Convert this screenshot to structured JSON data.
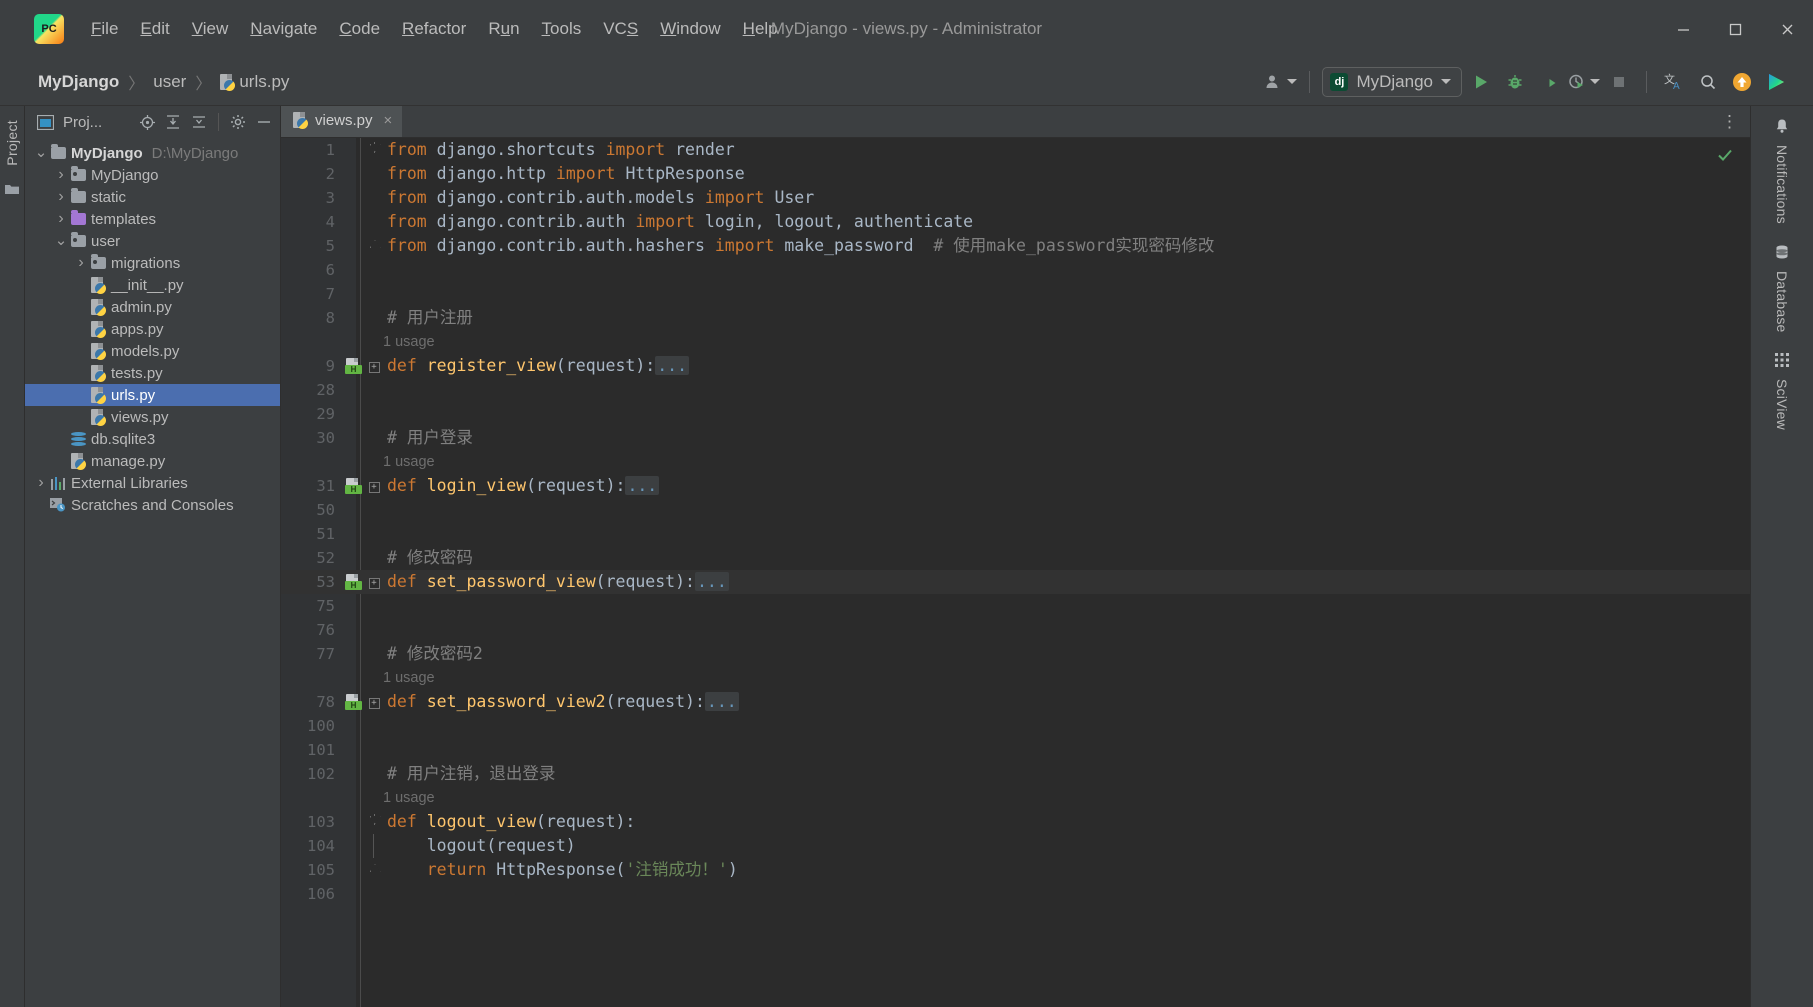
{
  "window": {
    "title": "MyDjango - views.py - Administrator",
    "minimize_label": "minimize-icon",
    "maximize_label": "maximize-icon",
    "close_label": "close-icon"
  },
  "menu": [
    {
      "label": "File",
      "mnemonic": "F"
    },
    {
      "label": "Edit",
      "mnemonic": "E"
    },
    {
      "label": "View",
      "mnemonic": "V"
    },
    {
      "label": "Navigate",
      "mnemonic": "N"
    },
    {
      "label": "Code",
      "mnemonic": "C"
    },
    {
      "label": "Refactor",
      "mnemonic": "R"
    },
    {
      "label": "Run",
      "mnemonic": "u"
    },
    {
      "label": "Tools",
      "mnemonic": "T"
    },
    {
      "label": "VCS",
      "mnemonic": "S"
    },
    {
      "label": "Window",
      "mnemonic": "W"
    },
    {
      "label": "Help",
      "mnemonic": "H"
    }
  ],
  "breadcrumbs": [
    {
      "label": "MyDjango",
      "bold": true,
      "icon": null
    },
    {
      "label": "user",
      "bold": false,
      "icon": null
    },
    {
      "label": "urls.py",
      "bold": false,
      "icon": "python-file-icon"
    }
  ],
  "toolbar": {
    "account_icon": "user-account-icon",
    "run_config": {
      "badge": "dj",
      "name": "MyDjango"
    },
    "run_icon": "run-icon",
    "debug_icon": "debug-icon",
    "coverage_icon": "run-with-coverage-icon",
    "profile_icon": "profiler-icon",
    "stop_icon": "stop-icon",
    "translate_icon": "translate-icon",
    "search_icon": "search-everywhere-icon",
    "update_icon": "update-project-icon",
    "ide_icon": "ide-feature-trainer-icon"
  },
  "left_strip": {
    "tabs": [
      {
        "label": "Project",
        "icon": "project-icon"
      }
    ],
    "structure_icon": "folder-strip-icon"
  },
  "project_panel": {
    "title": "Proj...",
    "header_icons": [
      "project-view-icon",
      "locate-icon",
      "expand-all-icon",
      "collapse-all-icon",
      "settings-gear-icon",
      "hide-icon"
    ],
    "tree": [
      {
        "label": "MyDjango",
        "sub": "D:\\MyDjango",
        "icon": "folder",
        "depth": 0,
        "twist": "open",
        "bold": true,
        "selected": false
      },
      {
        "label": "MyDjango",
        "sub": "",
        "icon": "folder-module",
        "depth": 1,
        "twist": "closed",
        "bold": false,
        "selected": false
      },
      {
        "label": "static",
        "sub": "",
        "icon": "folder",
        "depth": 1,
        "twist": "closed",
        "bold": false,
        "selected": false
      },
      {
        "label": "templates",
        "sub": "",
        "icon": "folder-purple",
        "depth": 1,
        "twist": "closed",
        "bold": false,
        "selected": false
      },
      {
        "label": "user",
        "sub": "",
        "icon": "folder-module",
        "depth": 1,
        "twist": "open",
        "bold": false,
        "selected": false
      },
      {
        "label": "migrations",
        "sub": "",
        "icon": "folder-module",
        "depth": 2,
        "twist": "closed",
        "bold": false,
        "selected": false
      },
      {
        "label": "__init__.py",
        "sub": "",
        "icon": "python",
        "depth": 2,
        "twist": "none",
        "bold": false,
        "selected": false
      },
      {
        "label": "admin.py",
        "sub": "",
        "icon": "python",
        "depth": 2,
        "twist": "none",
        "bold": false,
        "selected": false
      },
      {
        "label": "apps.py",
        "sub": "",
        "icon": "python",
        "depth": 2,
        "twist": "none",
        "bold": false,
        "selected": false
      },
      {
        "label": "models.py",
        "sub": "",
        "icon": "python",
        "depth": 2,
        "twist": "none",
        "bold": false,
        "selected": false
      },
      {
        "label": "tests.py",
        "sub": "",
        "icon": "python",
        "depth": 2,
        "twist": "none",
        "bold": false,
        "selected": false
      },
      {
        "label": "urls.py",
        "sub": "",
        "icon": "python",
        "depth": 2,
        "twist": "none",
        "bold": false,
        "selected": true
      },
      {
        "label": "views.py",
        "sub": "",
        "icon": "python",
        "depth": 2,
        "twist": "none",
        "bold": false,
        "selected": false
      },
      {
        "label": "db.sqlite3",
        "sub": "",
        "icon": "database",
        "depth": 1,
        "twist": "none",
        "bold": false,
        "selected": false
      },
      {
        "label": "manage.py",
        "sub": "",
        "icon": "python",
        "depth": 1,
        "twist": "none",
        "bold": false,
        "selected": false
      },
      {
        "label": "External Libraries",
        "sub": "",
        "icon": "libraries",
        "depth": 0,
        "twist": "closed",
        "bold": false,
        "selected": false
      },
      {
        "label": "Scratches and Consoles",
        "sub": "",
        "icon": "scratches",
        "depth": 0,
        "twist": "none",
        "bold": false,
        "selected": false
      }
    ]
  },
  "editor": {
    "tabs": [
      {
        "label": "views.py",
        "icon": "python-file-icon",
        "active": true,
        "close": "×"
      }
    ],
    "options_icon": "editor-options-icon",
    "inspection_status": "inspections-ok-icon",
    "lines": [
      {
        "num": "1",
        "fold": "top",
        "gicon": "",
        "caret": false,
        "tokens": [
          {
            "t": "from ",
            "c": "kw"
          },
          {
            "t": "django.shortcuts ",
            "c": "id"
          },
          {
            "t": "import ",
            "c": "kw"
          },
          {
            "t": "render",
            "c": "id"
          }
        ]
      },
      {
        "num": "2",
        "fold": "",
        "gicon": "",
        "caret": false,
        "tokens": [
          {
            "t": "from ",
            "c": "kw"
          },
          {
            "t": "django.http ",
            "c": "id"
          },
          {
            "t": "import ",
            "c": "kw"
          },
          {
            "t": "HttpResponse",
            "c": "id"
          }
        ]
      },
      {
        "num": "3",
        "fold": "",
        "gicon": "",
        "caret": false,
        "tokens": [
          {
            "t": "from ",
            "c": "kw"
          },
          {
            "t": "django.contrib.auth.models ",
            "c": "id"
          },
          {
            "t": "import ",
            "c": "kw"
          },
          {
            "t": "User",
            "c": "id"
          }
        ]
      },
      {
        "num": "4",
        "fold": "",
        "gicon": "",
        "caret": false,
        "tokens": [
          {
            "t": "from ",
            "c": "kw"
          },
          {
            "t": "django.contrib.auth ",
            "c": "id"
          },
          {
            "t": "import ",
            "c": "kw"
          },
          {
            "t": "login, logout, authenticate",
            "c": "id"
          }
        ]
      },
      {
        "num": "5",
        "fold": "bot",
        "gicon": "",
        "caret": false,
        "tokens": [
          {
            "t": "from ",
            "c": "kw"
          },
          {
            "t": "django.contrib.auth.hashers ",
            "c": "id"
          },
          {
            "t": "import ",
            "c": "kw"
          },
          {
            "t": "make_password",
            "c": "id"
          },
          {
            "t": "  # 使用make_password实现密码修改",
            "c": "cmt"
          }
        ]
      },
      {
        "num": "6",
        "fold": "",
        "gicon": "",
        "caret": false,
        "tokens": []
      },
      {
        "num": "7",
        "fold": "",
        "gicon": "",
        "caret": false,
        "tokens": []
      },
      {
        "num": "8",
        "fold": "",
        "gicon": "",
        "caret": false,
        "tokens": [
          {
            "t": "# 用户注册",
            "c": "cmt"
          }
        ]
      },
      {
        "num": "",
        "fold": "",
        "gicon": "",
        "caret": false,
        "usage": "1 usage",
        "tokens": []
      },
      {
        "num": "9",
        "fold": "box",
        "gicon": "http",
        "caret": false,
        "tokens": [
          {
            "t": "def ",
            "c": "kw"
          },
          {
            "t": "register_view",
            "c": "fn"
          },
          {
            "t": "(request):",
            "c": "id"
          },
          {
            "t": "...",
            "c": "ell"
          }
        ]
      },
      {
        "num": "28",
        "fold": "",
        "gicon": "",
        "caret": false,
        "tokens": []
      },
      {
        "num": "29",
        "fold": "",
        "gicon": "",
        "caret": false,
        "tokens": []
      },
      {
        "num": "30",
        "fold": "",
        "gicon": "",
        "caret": false,
        "tokens": [
          {
            "t": "# 用户登录",
            "c": "cmt"
          }
        ]
      },
      {
        "num": "",
        "fold": "",
        "gicon": "",
        "caret": false,
        "usage": "1 usage",
        "tokens": []
      },
      {
        "num": "31",
        "fold": "box",
        "gicon": "http",
        "caret": false,
        "tokens": [
          {
            "t": "def ",
            "c": "kw"
          },
          {
            "t": "login_view",
            "c": "fn"
          },
          {
            "t": "(request):",
            "c": "id"
          },
          {
            "t": "...",
            "c": "ell"
          }
        ]
      },
      {
        "num": "50",
        "fold": "",
        "gicon": "",
        "caret": false,
        "tokens": []
      },
      {
        "num": "51",
        "fold": "",
        "gicon": "",
        "caret": false,
        "tokens": []
      },
      {
        "num": "52",
        "fold": "",
        "gicon": "",
        "caret": false,
        "tokens": [
          {
            "t": "# 修改密码",
            "c": "cmt"
          }
        ]
      },
      {
        "num": "53",
        "fold": "box",
        "gicon": "http",
        "caret": true,
        "tokens": [
          {
            "t": "def ",
            "c": "kw"
          },
          {
            "t": "set_password_view",
            "c": "fn"
          },
          {
            "t": "(request):",
            "c": "id"
          },
          {
            "t": "...",
            "c": "ell"
          }
        ]
      },
      {
        "num": "75",
        "fold": "",
        "gicon": "",
        "caret": false,
        "tokens": []
      },
      {
        "num": "76",
        "fold": "",
        "gicon": "",
        "caret": false,
        "tokens": []
      },
      {
        "num": "77",
        "fold": "",
        "gicon": "",
        "caret": false,
        "tokens": [
          {
            "t": "# 修改密码2",
            "c": "cmt"
          }
        ]
      },
      {
        "num": "",
        "fold": "",
        "gicon": "",
        "caret": false,
        "usage": "1 usage",
        "tokens": []
      },
      {
        "num": "78",
        "fold": "box",
        "gicon": "http",
        "caret": false,
        "tokens": [
          {
            "t": "def ",
            "c": "kw"
          },
          {
            "t": "set_password_view2",
            "c": "fn"
          },
          {
            "t": "(request):",
            "c": "id"
          },
          {
            "t": "...",
            "c": "ell"
          }
        ]
      },
      {
        "num": "100",
        "fold": "",
        "gicon": "",
        "caret": false,
        "tokens": []
      },
      {
        "num": "101",
        "fold": "",
        "gicon": "",
        "caret": false,
        "tokens": []
      },
      {
        "num": "102",
        "fold": "",
        "gicon": "",
        "caret": false,
        "tokens": [
          {
            "t": "# 用户注销，退出登录",
            "c": "cmt"
          }
        ]
      },
      {
        "num": "",
        "fold": "",
        "gicon": "",
        "caret": false,
        "usage": "1 usage",
        "tokens": []
      },
      {
        "num": "103",
        "fold": "top",
        "gicon": "",
        "caret": false,
        "tokens": [
          {
            "t": "def ",
            "c": "kw"
          },
          {
            "t": "logout_view",
            "c": "fn"
          },
          {
            "t": "(request):",
            "c": "id"
          }
        ]
      },
      {
        "num": "104",
        "fold": "bar",
        "gicon": "",
        "caret": false,
        "tokens": [
          {
            "t": "    logout(request)",
            "c": "id"
          }
        ]
      },
      {
        "num": "105",
        "fold": "bot",
        "gicon": "",
        "caret": false,
        "tokens": [
          {
            "t": "    ",
            "c": "id"
          },
          {
            "t": "return ",
            "c": "kw"
          },
          {
            "t": "HttpResponse",
            "c": "id"
          },
          {
            "t": "(",
            "c": "id"
          },
          {
            "t": "'注销成功！'",
            "c": "str"
          },
          {
            "t": ")",
            "c": "id"
          }
        ]
      },
      {
        "num": "106",
        "fold": "",
        "gicon": "",
        "caret": false,
        "tokens": []
      }
    ]
  },
  "right_strip": {
    "tabs": [
      {
        "label": "Notifications",
        "icon": "bell-icon"
      },
      {
        "label": "Database",
        "icon": "database-icon"
      },
      {
        "label": "SciView",
        "icon": "sciview-grid-icon"
      }
    ]
  },
  "colors": {
    "bg_chrome": "#3c3f41",
    "bg_editor": "#2b2b2b",
    "gutter": "#313335",
    "selection": "#4b6eaf",
    "keyword": "#cc7832",
    "function": "#ffc66d",
    "identifier": "#a9b7c6",
    "comment": "#808080",
    "string": "#6a8759",
    "number": "#6897bb",
    "accent_green": "#62b543",
    "accent_orange": "#f0a732"
  }
}
